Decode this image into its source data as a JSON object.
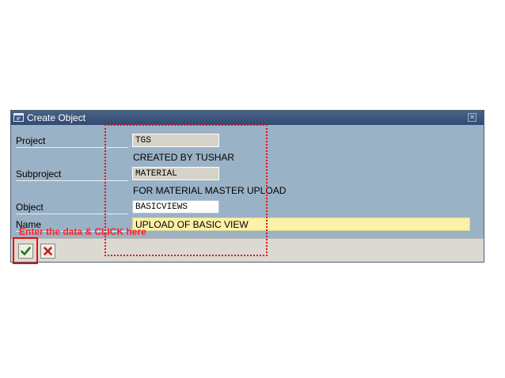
{
  "dialog": {
    "title": "Create Object",
    "colors": {
      "body": "#9ab2c6",
      "titlebar": "#2f4a74",
      "annotation": "#e01010"
    }
  },
  "form": {
    "project_label": "Project",
    "project_value": "TGS",
    "project_desc": "CREATED BY TUSHAR",
    "subproject_label": "Subproject",
    "subproject_value": "MATERIAL",
    "subproject_desc": "FOR MATERIAL MASTER UPLOAD",
    "object_label": "Object",
    "object_value": "BASICVIEWS",
    "name_label": "Name",
    "name_value": "UPLOAD OF BASIC VIEW"
  },
  "annotation": {
    "hint": "Enter the data & CLICK here"
  },
  "icons": {
    "title": "window-icon",
    "close": "close-icon",
    "ok": "checkmark-icon",
    "cancel": "cancel-x-icon"
  }
}
